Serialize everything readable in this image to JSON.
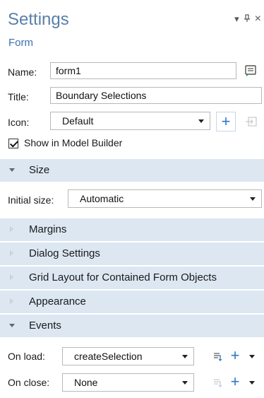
{
  "header": {
    "title": "Settings",
    "subtitle": "Form",
    "controls": {
      "dropdown": "▾",
      "pin": "⊥",
      "close": "×"
    }
  },
  "form": {
    "name_label": "Name:",
    "name_value": "form1",
    "title_label": "Title:",
    "title_value": "Boundary Selections",
    "icon_label": "Icon:",
    "icon_value": "Default",
    "show_in_model_builder_label": "Show in Model Builder",
    "show_in_model_builder_checked": true
  },
  "sections": {
    "size": {
      "title": "Size",
      "expanded": true
    },
    "margins": {
      "title": "Margins",
      "expanded": false
    },
    "dialog_settings": {
      "title": "Dialog Settings",
      "expanded": false
    },
    "grid_layout": {
      "title": "Grid Layout for Contained Form Objects",
      "expanded": false
    },
    "appearance": {
      "title": "Appearance",
      "expanded": false
    },
    "events": {
      "title": "Events",
      "expanded": true
    }
  },
  "size": {
    "initial_size_label": "Initial size:",
    "initial_size_value": "Automatic"
  },
  "events": {
    "on_load_label": "On load:",
    "on_load_value": "createSelection",
    "on_close_label": "On close:",
    "on_close_value": "None"
  },
  "icons": {
    "edit_name": "note-edit-icon",
    "add": "plus-icon",
    "import": "import-icon",
    "go_to_method": "go-to-method-icon"
  },
  "colors": {
    "title": "#5a7fa8",
    "subtitle": "#3b72b0",
    "section_bg": "#dce7f2",
    "accent": "#2f76c9"
  }
}
